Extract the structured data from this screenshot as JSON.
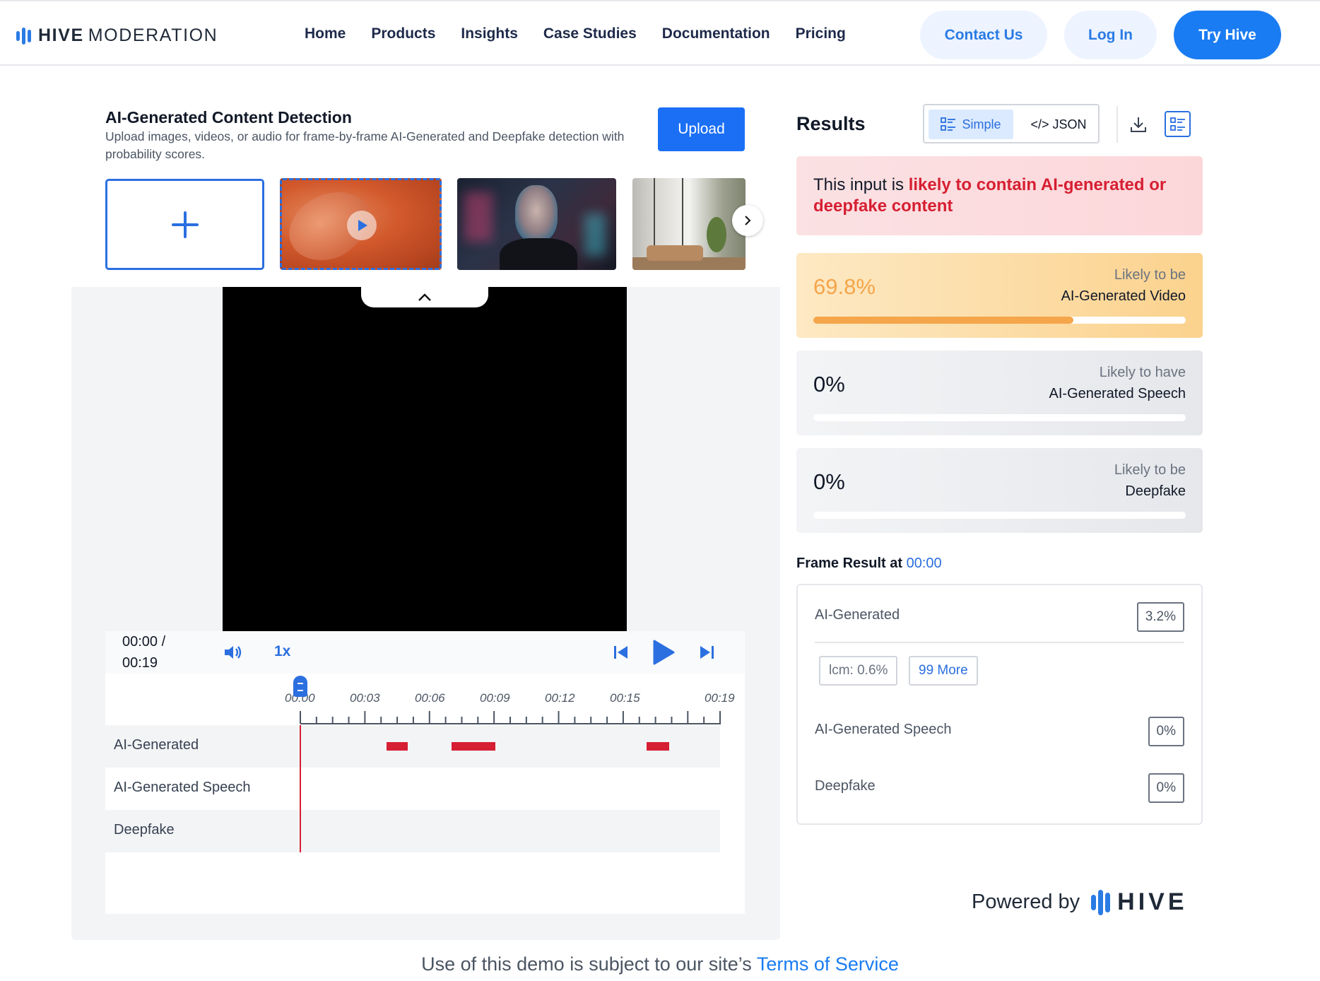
{
  "header": {
    "logo_bold": "HIVE",
    "logo_light": "MODERATION",
    "nav": [
      "Home",
      "Products",
      "Insights",
      "Case Studies",
      "Documentation",
      "Pricing"
    ],
    "contact_label": "Contact Us",
    "login_label": "Log In",
    "try_label": "Try Hive"
  },
  "detector": {
    "title": "AI-Generated Content Detection",
    "description": "Upload images, videos, or audio for frame-by-frame AI-Generated and Deepfake detection with probability scores.",
    "upload_label": "Upload"
  },
  "player": {
    "time_current": "00:00 /",
    "time_total": "00:19",
    "speed": "1x",
    "ticks": [
      "00:00",
      "00:03",
      "00:06",
      "00:09",
      "00:12",
      "00:15",
      "00:19"
    ],
    "tracks": [
      "AI-Generated",
      "AI-Generated Speech",
      "Deepfake"
    ]
  },
  "results": {
    "title": "Results",
    "toggle_simple": "Simple",
    "toggle_json": "</> JSON",
    "alert_prefix": "This input is ",
    "alert_emphasis": "likely to contain AI-generated or deepfake content",
    "scores": [
      {
        "pct": "69.8%",
        "line1": "Likely to be",
        "line2": "AI-Generated Video",
        "value": 0.698
      },
      {
        "pct": "0%",
        "line1": "Likely to have",
        "line2": "AI-Generated Speech",
        "value": 0
      },
      {
        "pct": "0%",
        "line1": "Likely to be",
        "line2": "Deepfake",
        "value": 0
      }
    ],
    "frame_title": "Frame Result at ",
    "frame_time": "00:00",
    "frame_rows": [
      {
        "label": "AI-Generated",
        "pct": "3.2%"
      },
      {
        "label": "AI-Generated Speech",
        "pct": "0%"
      },
      {
        "label": "Deepfake",
        "pct": "0%"
      }
    ],
    "sub_chip": "lcm: 0.6%",
    "more_chip": "99 More"
  },
  "powered": {
    "text": "Powered by",
    "brand": "HIVE"
  },
  "footer": {
    "text": "Use of this demo is subject to our site’s ",
    "link": "Terms of Service"
  },
  "colors": {
    "accent": "#1a7cf2",
    "danger": "#d61f32",
    "warning": "#f5a54a"
  }
}
